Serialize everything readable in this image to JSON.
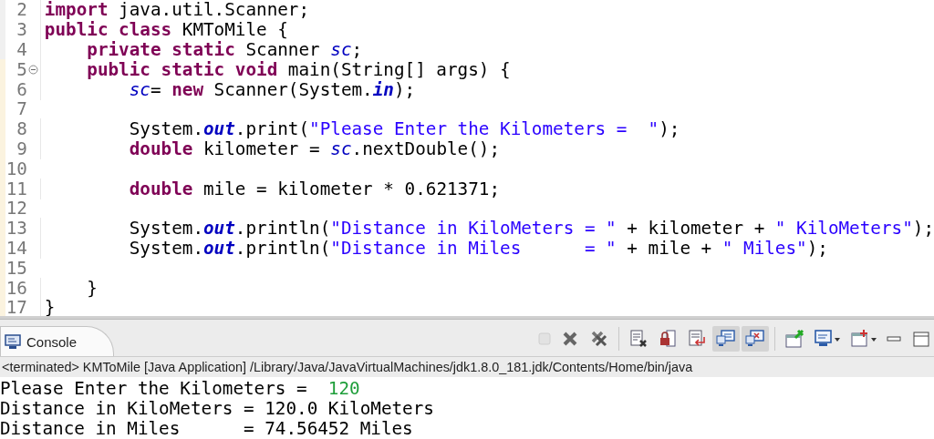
{
  "editor": {
    "lines": [
      {
        "number": "2",
        "foldable": false,
        "tokens": [
          {
            "kind": "keyword",
            "text": "import"
          },
          {
            "kind": "plain",
            "text": " java.util.Scanner;"
          }
        ]
      },
      {
        "number": "3",
        "foldable": false,
        "tokens": [
          {
            "kind": "keyword",
            "text": "public class"
          },
          {
            "kind": "plain",
            "text": " KMToMile {"
          }
        ]
      },
      {
        "number": "4",
        "foldable": false,
        "tokens": [
          {
            "kind": "keyword",
            "text": "    private static"
          },
          {
            "kind": "plain",
            "text": " Scanner "
          },
          {
            "kind": "field",
            "text": "sc"
          },
          {
            "kind": "plain",
            "text": ";"
          }
        ]
      },
      {
        "number": "5",
        "foldable": true,
        "tokens": [
          {
            "kind": "keyword",
            "text": "    public static void"
          },
          {
            "kind": "plain",
            "text": " main(String[] args) {"
          }
        ]
      },
      {
        "number": "6",
        "foldable": false,
        "tokens": [
          {
            "kind": "field",
            "text": "        sc"
          },
          {
            "kind": "plain",
            "text": "= "
          },
          {
            "kind": "keyword",
            "text": "new"
          },
          {
            "kind": "plain",
            "text": " Scanner(System."
          },
          {
            "kind": "static",
            "text": "in"
          },
          {
            "kind": "plain",
            "text": ");"
          }
        ]
      },
      {
        "number": "7",
        "foldable": false
      },
      {
        "number": "8",
        "foldable": false,
        "tokens": [
          {
            "kind": "plain",
            "text": "        System."
          },
          {
            "kind": "static",
            "text": "out"
          },
          {
            "kind": "plain",
            "text": ".print("
          },
          {
            "kind": "string",
            "text": "\"Please Enter the Kilometers =  \""
          },
          {
            "kind": "plain",
            "text": ");"
          }
        ]
      },
      {
        "number": "9",
        "foldable": false,
        "tokens": [
          {
            "kind": "keyword",
            "text": "        double"
          },
          {
            "kind": "plain",
            "text": " kilometer = "
          },
          {
            "kind": "field",
            "text": "sc"
          },
          {
            "kind": "plain",
            "text": ".nextDouble();"
          }
        ]
      },
      {
        "number": "10",
        "foldable": false
      },
      {
        "number": "11",
        "foldable": false,
        "tokens": [
          {
            "kind": "keyword",
            "text": "        double"
          },
          {
            "kind": "plain",
            "text": " mile = kilometer * 0.621371;"
          }
        ]
      },
      {
        "number": "12",
        "foldable": false
      },
      {
        "number": "13",
        "foldable": false,
        "tokens": [
          {
            "kind": "plain",
            "text": "        System."
          },
          {
            "kind": "static",
            "text": "out"
          },
          {
            "kind": "plain",
            "text": ".println("
          },
          {
            "kind": "string",
            "text": "\"Distance in KiloMeters = \""
          },
          {
            "kind": "plain",
            "text": " + kilometer + "
          },
          {
            "kind": "string",
            "text": "\" KiloMeters\""
          },
          {
            "kind": "plain",
            "text": ");"
          }
        ]
      },
      {
        "number": "14",
        "foldable": false,
        "tokens": [
          {
            "kind": "plain",
            "text": "        System."
          },
          {
            "kind": "static",
            "text": "out"
          },
          {
            "kind": "plain",
            "text": ".println("
          },
          {
            "kind": "string",
            "text": "\"Distance in Miles      = \""
          },
          {
            "kind": "plain",
            "text": " + mile + "
          },
          {
            "kind": "string",
            "text": "\" Miles\""
          },
          {
            "kind": "plain",
            "text": ");"
          }
        ]
      },
      {
        "number": "15",
        "foldable": false
      },
      {
        "number": "16",
        "foldable": false,
        "tokens": [
          {
            "kind": "plain",
            "text": "    }"
          }
        ]
      },
      {
        "number": "17",
        "foldable": false,
        "tokens": [
          {
            "kind": "plain",
            "text": "}"
          }
        ]
      }
    ]
  },
  "console": {
    "tab": {
      "label": "Console",
      "selected": true
    },
    "toolbar": [
      {
        "kind": "stop",
        "on": false,
        "disabled": true
      },
      {
        "kind": "remove",
        "on": false,
        "disabled": false
      },
      {
        "kind": "remove-all",
        "on": false,
        "disabled": false
      },
      {
        "kind": "clear",
        "on": false,
        "disabled": false
      },
      {
        "kind": "scroll-lock",
        "on": false,
        "disabled": false
      },
      {
        "kind": "word-wrap",
        "on": false,
        "disabled": false
      },
      {
        "kind": "show-stdout",
        "on": true,
        "disabled": false
      },
      {
        "kind": "show-stderr",
        "on": true,
        "disabled": false
      },
      {
        "kind": "pin",
        "on": false,
        "disabled": false
      },
      {
        "kind": "display",
        "on": false,
        "disabled": false
      },
      {
        "kind": "new-console",
        "on": false,
        "disabled": false
      },
      {
        "kind": "minimize",
        "on": false,
        "disabled": false
      },
      {
        "kind": "maximize",
        "on": false,
        "disabled": false
      }
    ],
    "status": "<terminated> KMToMile [Java Application] /Library/Java/JavaVirtualMachines/jdk1.8.0_181.jdk/Contents/Home/bin/java",
    "output": [
      [
        {
          "kind": "output",
          "text": "Please Enter the Kilometers =  "
        },
        {
          "kind": "input",
          "text": "120"
        }
      ],
      [
        {
          "kind": "output",
          "text": "Distance in KiloMeters = 120.0 KiloMeters"
        }
      ],
      [
        {
          "kind": "output",
          "text": "Distance in Miles      = 74.56452 Miles"
        }
      ]
    ]
  }
}
